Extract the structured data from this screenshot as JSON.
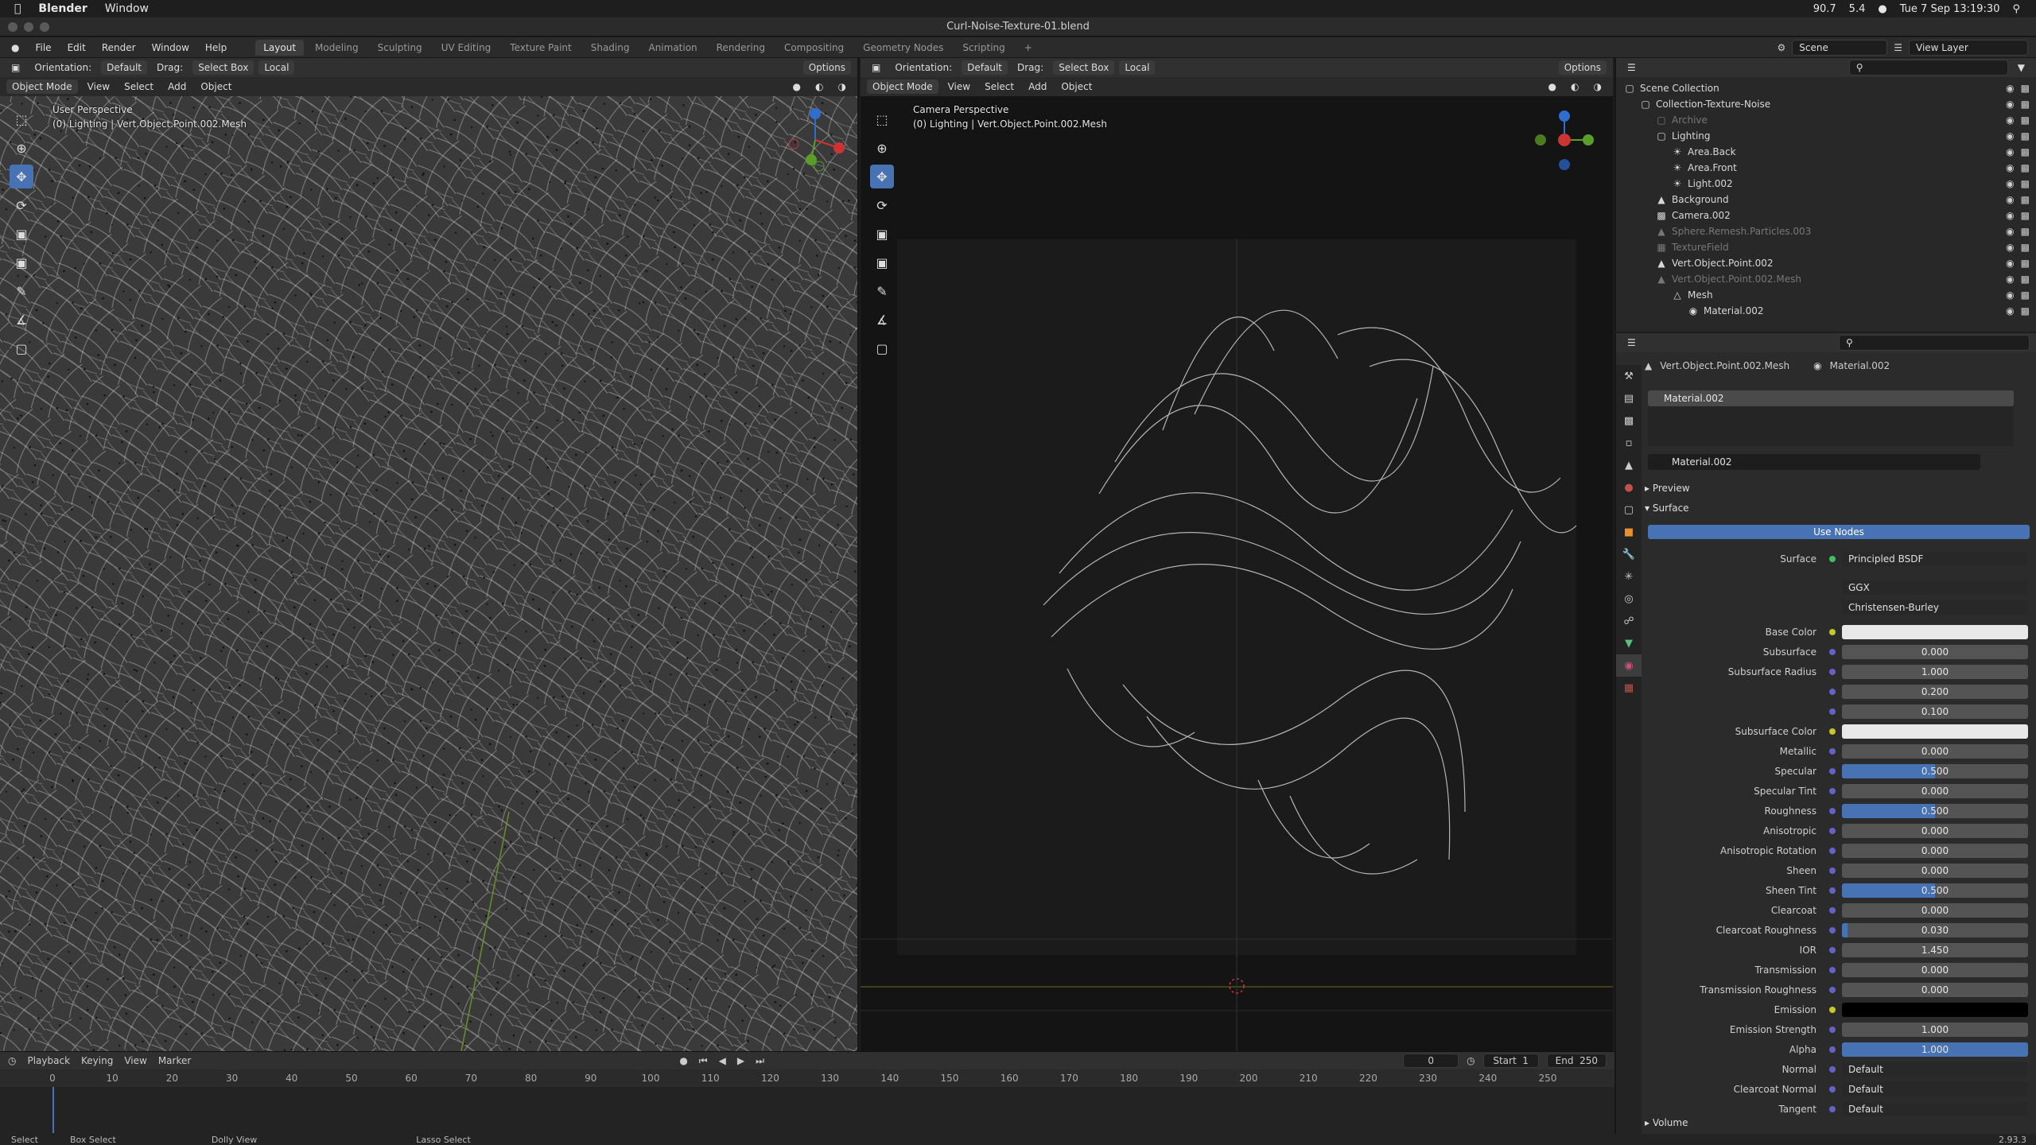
{
  "mac": {
    "app": "Blender",
    "menu1": "Window",
    "clock": "Tue 7 Sep  13:19:30",
    "battery": "90.7",
    "net": "5.4"
  },
  "window_title": "Curl-Noise-Texture-01.blend",
  "menus": [
    "File",
    "Edit",
    "Render",
    "Window",
    "Help"
  ],
  "workspaces": [
    "Layout",
    "Modeling",
    "Sculpting",
    "UV Editing",
    "Texture Paint",
    "Shading",
    "Animation",
    "Rendering",
    "Compositing",
    "Geometry Nodes",
    "Scripting"
  ],
  "active_workspace": "Layout",
  "scene": "Scene",
  "view_layer": "View Layer",
  "left_vp": {
    "orientation_label": "Orientation:",
    "orientation": "Default",
    "drag_label": "Drag:",
    "drag": "Select Box",
    "pivot": "Local",
    "options": "Options",
    "mode": "Object Mode",
    "view": "View",
    "select": "Select",
    "add": "Add",
    "object": "Object",
    "overlay1": "User Perspective",
    "overlay2": "(0) Lighting | Vert.Object.Point.002.Mesh"
  },
  "right_vp": {
    "orientation_label": "Orientation:",
    "orientation": "Default",
    "drag_label": "Drag:",
    "drag": "Select Box",
    "pivot": "Local",
    "options": "Options",
    "mode": "Object Mode",
    "view": "View",
    "select": "Select",
    "add": "Add",
    "object": "Object",
    "overlay1": "Camera Perspective",
    "overlay2": "(0) Lighting | Vert.Object.Point.002.Mesh"
  },
  "outliner": [
    {
      "label": "Scene Collection",
      "indent": 0,
      "icon": "collection-icon",
      "dim": false
    },
    {
      "label": "Collection-Texture-Noise",
      "indent": 1,
      "icon": "collection-icon",
      "dim": false
    },
    {
      "label": "Archive",
      "indent": 2,
      "icon": "collection-icon",
      "dim": true
    },
    {
      "label": "Lighting",
      "indent": 2,
      "icon": "collection-icon",
      "dim": false
    },
    {
      "label": "Area.Back",
      "indent": 3,
      "icon": "light-icon",
      "dim": false
    },
    {
      "label": "Area.Front",
      "indent": 3,
      "icon": "light-icon",
      "dim": false
    },
    {
      "label": "Light.002",
      "indent": 3,
      "icon": "light-icon",
      "dim": false
    },
    {
      "label": "Background",
      "indent": 2,
      "icon": "mesh-icon",
      "dim": false
    },
    {
      "label": "Camera.002",
      "indent": 2,
      "icon": "camera-icon",
      "dim": false
    },
    {
      "label": "Sphere.Remesh.Particles.003",
      "indent": 2,
      "icon": "mesh-icon",
      "dim": true
    },
    {
      "label": "TextureField",
      "indent": 2,
      "icon": "texture-icon",
      "dim": true
    },
    {
      "label": "Vert.Object.Point.002",
      "indent": 2,
      "icon": "mesh-icon",
      "dim": false
    },
    {
      "label": "Vert.Object.Point.002.Mesh",
      "indent": 2,
      "icon": "mesh-icon",
      "dim": true
    },
    {
      "label": "Mesh",
      "indent": 3,
      "icon": "mesh-data-icon",
      "dim": false
    },
    {
      "label": "Material.002",
      "indent": 4,
      "icon": "material-icon",
      "dim": false
    }
  ],
  "props": {
    "breadcrumb_object": "Vert.Object.Point.002.Mesh",
    "breadcrumb_material": "Material.002",
    "slot": "Material.002",
    "material_name": "Material.002",
    "preview": "Preview",
    "surface_section": "Surface",
    "use_nodes": "Use Nodes",
    "surface_label": "Surface",
    "surface_value": "Principled BSDF",
    "distribution": "GGX",
    "subsurface_method": "Christensen-Burley",
    "volume": "Volume"
  },
  "params": [
    {
      "label": "Base Color",
      "value": "",
      "kind": "color",
      "color": "#e8e8e8",
      "dot": "#c7c729"
    },
    {
      "label": "Subsurface",
      "value": "0.000",
      "fill": 0
    },
    {
      "label": "Subsurface Radius",
      "value": "1.000",
      "fill": 0
    },
    {
      "label": "",
      "value": "0.200",
      "fill": 0
    },
    {
      "label": "",
      "value": "0.100",
      "fill": 0
    },
    {
      "label": "Subsurface Color",
      "value": "",
      "kind": "color",
      "color": "#e8e8e8",
      "dot": "#c7c729"
    },
    {
      "label": "Metallic",
      "value": "0.000",
      "fill": 0
    },
    {
      "label": "Specular",
      "value": "0.500",
      "fill": 0.5
    },
    {
      "label": "Specular Tint",
      "value": "0.000",
      "fill": 0
    },
    {
      "label": "Roughness",
      "value": "0.500",
      "fill": 0.5
    },
    {
      "label": "Anisotropic",
      "value": "0.000",
      "fill": 0
    },
    {
      "label": "Anisotropic Rotation",
      "value": "0.000",
      "fill": 0
    },
    {
      "label": "Sheen",
      "value": "0.000",
      "fill": 0
    },
    {
      "label": "Sheen Tint",
      "value": "0.500",
      "fill": 0.5
    },
    {
      "label": "Clearcoat",
      "value": "0.000",
      "fill": 0
    },
    {
      "label": "Clearcoat Roughness",
      "value": "0.030",
      "fill": 0.03
    },
    {
      "label": "IOR",
      "value": "1.450",
      "fill": 0
    },
    {
      "label": "Transmission",
      "value": "0.000",
      "fill": 0
    },
    {
      "label": "Transmission Roughness",
      "value": "0.000",
      "fill": 0
    },
    {
      "label": "Emission",
      "value": "",
      "kind": "color",
      "color": "#000000",
      "dot": "#c7c729"
    },
    {
      "label": "Emission Strength",
      "value": "1.000",
      "fill": 0
    },
    {
      "label": "Alpha",
      "value": "1.000",
      "fill": 1
    },
    {
      "label": "Normal",
      "value": "Default",
      "kind": "text"
    },
    {
      "label": "Clearcoat Normal",
      "value": "Default",
      "kind": "text"
    },
    {
      "label": "Tangent",
      "value": "Default",
      "kind": "text"
    }
  ],
  "timeline": {
    "playback": "Playback",
    "keying": "Keying",
    "view": "View",
    "marker": "Marker",
    "current": "0",
    "start_label": "Start",
    "start": "1",
    "end_label": "End",
    "end": "250",
    "ticks": [
      "0",
      "10",
      "20",
      "30",
      "40",
      "50",
      "60",
      "70",
      "80",
      "90",
      "100",
      "110",
      "120",
      "130",
      "140",
      "150",
      "160",
      "170",
      "180",
      "190",
      "200",
      "210",
      "220",
      "230",
      "240",
      "250"
    ]
  },
  "status": {
    "select": "Select",
    "box": "Box Select",
    "dolly": "Dolly View",
    "lasso": "Lasso Select",
    "version": "2.93.3"
  }
}
